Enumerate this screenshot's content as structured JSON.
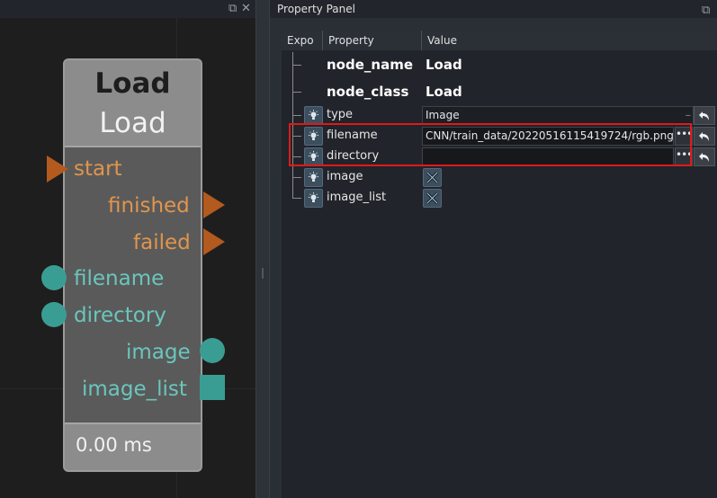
{
  "property_panel": {
    "title": "Property Panel",
    "columns": [
      "Expo",
      "Property",
      "Value"
    ],
    "rows": {
      "node_name": {
        "property": "node_name",
        "value": "Load"
      },
      "node_class": {
        "property": "node_class",
        "value": "Load"
      },
      "type": {
        "property": "type",
        "value": "Image"
      },
      "filename": {
        "property": "filename",
        "value": "CNN/train_data/20220516115419724/rgb.png"
      },
      "directory": {
        "property": "directory",
        "value": ""
      },
      "image": {
        "property": "image"
      },
      "image_list": {
        "property": "image_list"
      }
    },
    "dots_label": "•••"
  },
  "node": {
    "title": "Load",
    "subtitle": "Load",
    "ports": {
      "start": "start",
      "finished": "finished",
      "failed": "failed",
      "filename": "filename",
      "directory": "directory",
      "image": "image",
      "image_list": "image_list"
    },
    "timing": "0.00 ms"
  },
  "colors": {
    "outcome_port": "#b35a1f",
    "outcome_label": "#e0954d",
    "data_port": "#3a9d94",
    "data_label": "#6ac6bd",
    "highlight": "#e01919"
  },
  "icons": {
    "expose": "lightbulb-icon",
    "reset": "undo-arrow-icon",
    "dock": "float-icon",
    "close": "close-icon",
    "image_slot": "image-slot-icon"
  }
}
